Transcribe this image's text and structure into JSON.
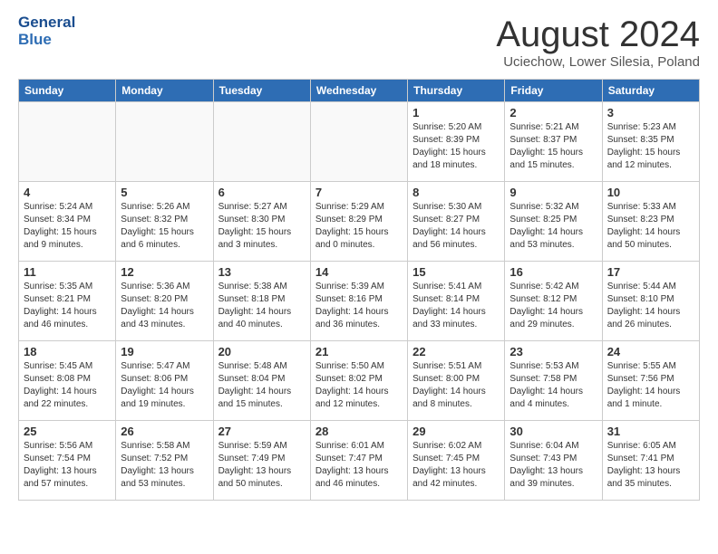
{
  "header": {
    "logo_line1": "General",
    "logo_line2": "Blue",
    "title": "August 2024",
    "subtitle": "Uciechow, Lower Silesia, Poland"
  },
  "weekdays": [
    "Sunday",
    "Monday",
    "Tuesday",
    "Wednesday",
    "Thursday",
    "Friday",
    "Saturday"
  ],
  "weeks": [
    [
      {
        "day": "",
        "info": ""
      },
      {
        "day": "",
        "info": ""
      },
      {
        "day": "",
        "info": ""
      },
      {
        "day": "",
        "info": ""
      },
      {
        "day": "1",
        "info": "Sunrise: 5:20 AM\nSunset: 8:39 PM\nDaylight: 15 hours\nand 18 minutes."
      },
      {
        "day": "2",
        "info": "Sunrise: 5:21 AM\nSunset: 8:37 PM\nDaylight: 15 hours\nand 15 minutes."
      },
      {
        "day": "3",
        "info": "Sunrise: 5:23 AM\nSunset: 8:35 PM\nDaylight: 15 hours\nand 12 minutes."
      }
    ],
    [
      {
        "day": "4",
        "info": "Sunrise: 5:24 AM\nSunset: 8:34 PM\nDaylight: 15 hours\nand 9 minutes."
      },
      {
        "day": "5",
        "info": "Sunrise: 5:26 AM\nSunset: 8:32 PM\nDaylight: 15 hours\nand 6 minutes."
      },
      {
        "day": "6",
        "info": "Sunrise: 5:27 AM\nSunset: 8:30 PM\nDaylight: 15 hours\nand 3 minutes."
      },
      {
        "day": "7",
        "info": "Sunrise: 5:29 AM\nSunset: 8:29 PM\nDaylight: 15 hours\nand 0 minutes."
      },
      {
        "day": "8",
        "info": "Sunrise: 5:30 AM\nSunset: 8:27 PM\nDaylight: 14 hours\nand 56 minutes."
      },
      {
        "day": "9",
        "info": "Sunrise: 5:32 AM\nSunset: 8:25 PM\nDaylight: 14 hours\nand 53 minutes."
      },
      {
        "day": "10",
        "info": "Sunrise: 5:33 AM\nSunset: 8:23 PM\nDaylight: 14 hours\nand 50 minutes."
      }
    ],
    [
      {
        "day": "11",
        "info": "Sunrise: 5:35 AM\nSunset: 8:21 PM\nDaylight: 14 hours\nand 46 minutes."
      },
      {
        "day": "12",
        "info": "Sunrise: 5:36 AM\nSunset: 8:20 PM\nDaylight: 14 hours\nand 43 minutes."
      },
      {
        "day": "13",
        "info": "Sunrise: 5:38 AM\nSunset: 8:18 PM\nDaylight: 14 hours\nand 40 minutes."
      },
      {
        "day": "14",
        "info": "Sunrise: 5:39 AM\nSunset: 8:16 PM\nDaylight: 14 hours\nand 36 minutes."
      },
      {
        "day": "15",
        "info": "Sunrise: 5:41 AM\nSunset: 8:14 PM\nDaylight: 14 hours\nand 33 minutes."
      },
      {
        "day": "16",
        "info": "Sunrise: 5:42 AM\nSunset: 8:12 PM\nDaylight: 14 hours\nand 29 minutes."
      },
      {
        "day": "17",
        "info": "Sunrise: 5:44 AM\nSunset: 8:10 PM\nDaylight: 14 hours\nand 26 minutes."
      }
    ],
    [
      {
        "day": "18",
        "info": "Sunrise: 5:45 AM\nSunset: 8:08 PM\nDaylight: 14 hours\nand 22 minutes."
      },
      {
        "day": "19",
        "info": "Sunrise: 5:47 AM\nSunset: 8:06 PM\nDaylight: 14 hours\nand 19 minutes."
      },
      {
        "day": "20",
        "info": "Sunrise: 5:48 AM\nSunset: 8:04 PM\nDaylight: 14 hours\nand 15 minutes."
      },
      {
        "day": "21",
        "info": "Sunrise: 5:50 AM\nSunset: 8:02 PM\nDaylight: 14 hours\nand 12 minutes."
      },
      {
        "day": "22",
        "info": "Sunrise: 5:51 AM\nSunset: 8:00 PM\nDaylight: 14 hours\nand 8 minutes."
      },
      {
        "day": "23",
        "info": "Sunrise: 5:53 AM\nSunset: 7:58 PM\nDaylight: 14 hours\nand 4 minutes."
      },
      {
        "day": "24",
        "info": "Sunrise: 5:55 AM\nSunset: 7:56 PM\nDaylight: 14 hours\nand 1 minute."
      }
    ],
    [
      {
        "day": "25",
        "info": "Sunrise: 5:56 AM\nSunset: 7:54 PM\nDaylight: 13 hours\nand 57 minutes."
      },
      {
        "day": "26",
        "info": "Sunrise: 5:58 AM\nSunset: 7:52 PM\nDaylight: 13 hours\nand 53 minutes."
      },
      {
        "day": "27",
        "info": "Sunrise: 5:59 AM\nSunset: 7:49 PM\nDaylight: 13 hours\nand 50 minutes."
      },
      {
        "day": "28",
        "info": "Sunrise: 6:01 AM\nSunset: 7:47 PM\nDaylight: 13 hours\nand 46 minutes."
      },
      {
        "day": "29",
        "info": "Sunrise: 6:02 AM\nSunset: 7:45 PM\nDaylight: 13 hours\nand 42 minutes."
      },
      {
        "day": "30",
        "info": "Sunrise: 6:04 AM\nSunset: 7:43 PM\nDaylight: 13 hours\nand 39 minutes."
      },
      {
        "day": "31",
        "info": "Sunrise: 6:05 AM\nSunset: 7:41 PM\nDaylight: 13 hours\nand 35 minutes."
      }
    ]
  ]
}
